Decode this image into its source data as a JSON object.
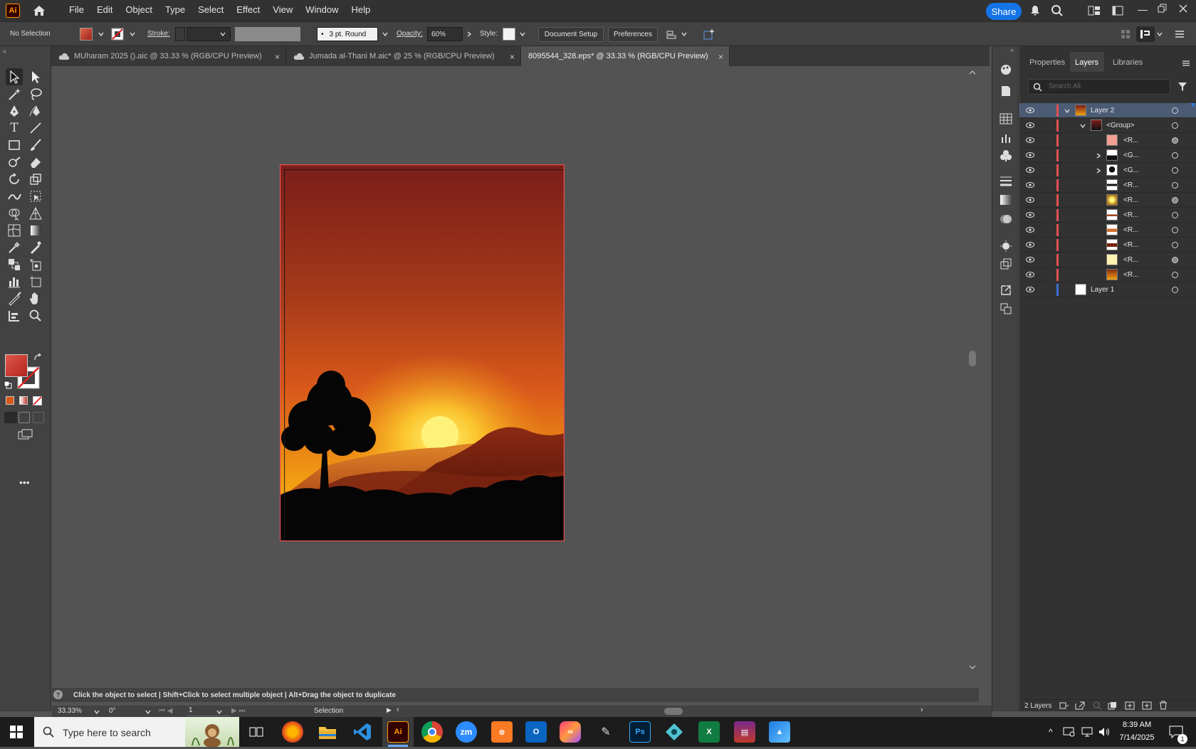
{
  "app": {
    "logo_text": "Ai"
  },
  "menu": {
    "items": [
      "File",
      "Edit",
      "Object",
      "Type",
      "Select",
      "Effect",
      "View",
      "Window",
      "Help"
    ],
    "share_label": "Share"
  },
  "control_bar": {
    "selection_state": "No Selection",
    "stroke_label": "Stroke:",
    "brush_value": "3 pt. Round",
    "opacity_label": "Opacity:",
    "opacity_value": "60%",
    "style_label": "Style:",
    "document_setup_label": "Document Setup",
    "preferences_label": "Preferences"
  },
  "tabs": [
    {
      "label": "MUharam 2025 ().aic @ 33.33 % (RGB/CPU Preview)",
      "close": "×"
    },
    {
      "label": "Jumada al-Thani M.aic* @ 25 % (RGB/CPU Preview)",
      "close": "×"
    },
    {
      "label": "8095544_328.eps* @ 33.33 % (RGB/CPU Preview)",
      "close": "×"
    }
  ],
  "panel": {
    "tabs": [
      "Properties",
      "Layers",
      "Libraries"
    ],
    "active_tab": "Layers",
    "search_placeholder": "Search All",
    "layers_count": "2 Layers",
    "rows": [
      {
        "name": "Layer 2",
        "bar": "#e05252",
        "selected": true
      },
      {
        "name": "<Group>",
        "bar": "#e05252",
        "selected": false
      },
      {
        "name": "<R...",
        "bar": "#e05252",
        "selected": false
      },
      {
        "name": "<G...",
        "bar": "#e05252",
        "selected": false
      },
      {
        "name": "<G...",
        "bar": "#e05252",
        "selected": false
      },
      {
        "name": "<R...",
        "bar": "#e05252",
        "selected": false
      },
      {
        "name": "<R...",
        "bar": "#e05252",
        "selected": false
      },
      {
        "name": "<R...",
        "bar": "#e05252",
        "selected": false
      },
      {
        "name": "<R...",
        "bar": "#e05252",
        "selected": false
      },
      {
        "name": "<R...",
        "bar": "#e05252",
        "selected": false
      },
      {
        "name": "<R...",
        "bar": "#e05252",
        "selected": false
      },
      {
        "name": "<R...",
        "bar": "#e05252",
        "selected": false
      },
      {
        "name": "Layer 1",
        "bar": "#3b6fd6",
        "selected": false
      }
    ]
  },
  "status": {
    "hint": "Click the object to select  |  Shift+Click to select multiple object  |  Alt+Drag the object to duplicate",
    "zoom": "33.33%",
    "rotation": "0°",
    "artboard": "1",
    "tool_name": "Selection"
  },
  "taskbar": {
    "search_placeholder": "Type here to search",
    "time": "8:39 AM",
    "date": "7/14/2025",
    "notification_count": "1"
  },
  "colors": {
    "accent": "#1473e6",
    "fill_swatch": "#c0392b",
    "sky_top": "#7a1d1a",
    "sky_mid": "#d9591a",
    "sun": "#fff27a"
  }
}
